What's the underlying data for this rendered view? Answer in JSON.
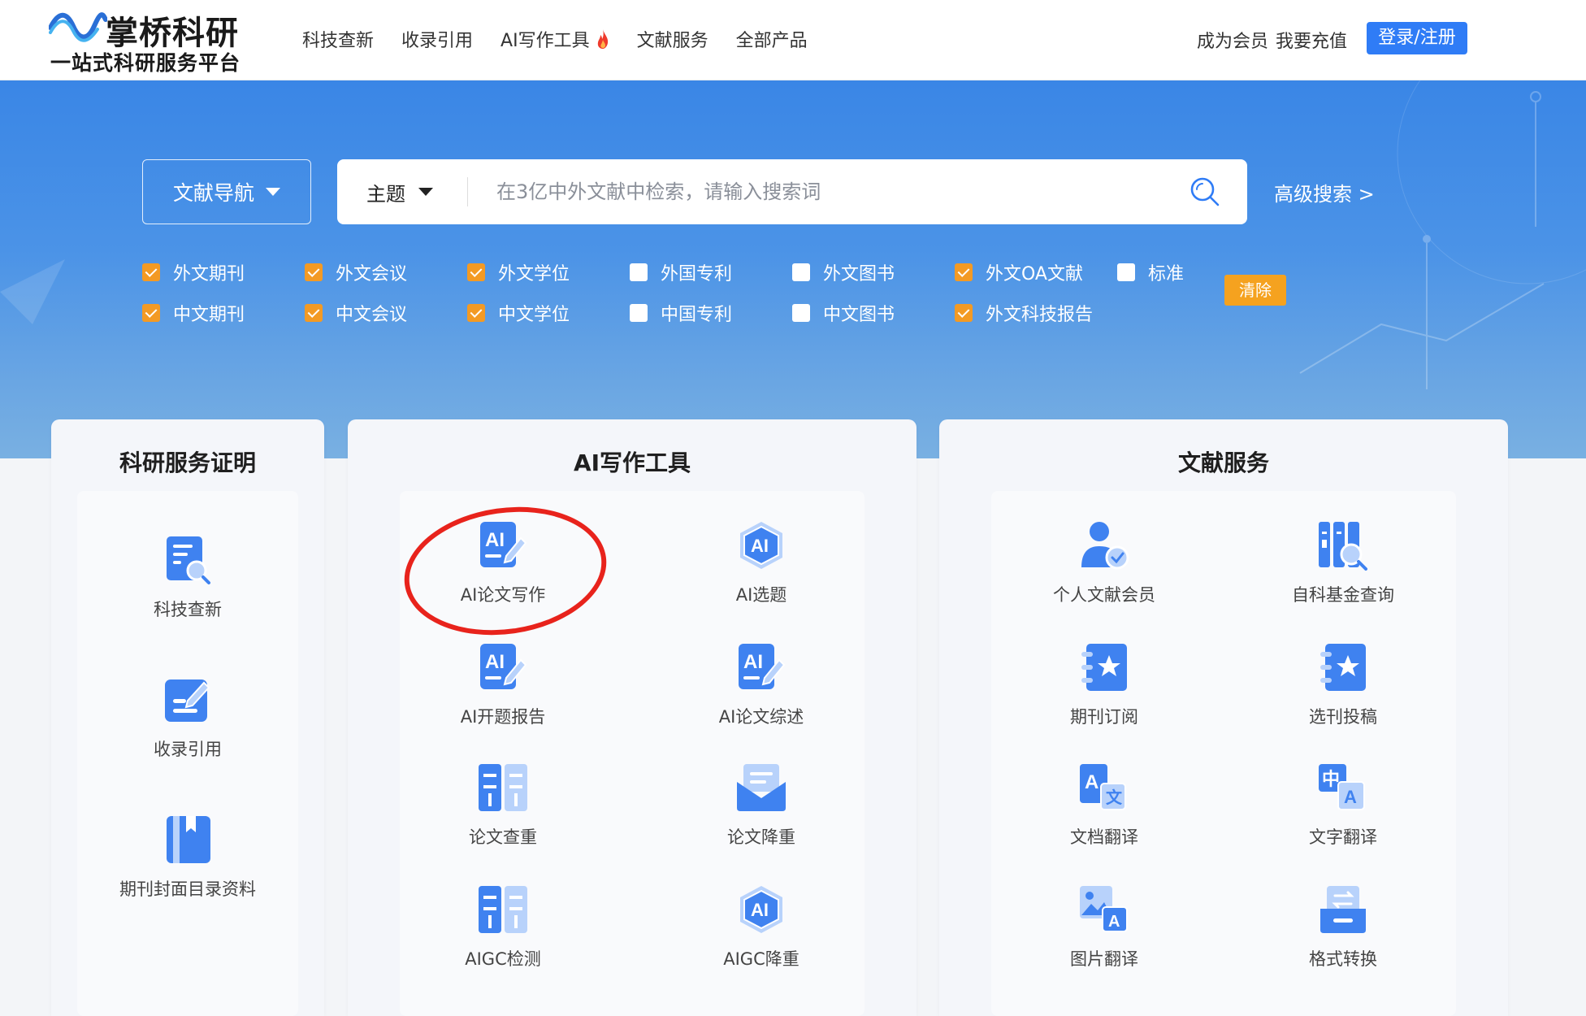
{
  "header": {
    "logo_title": "掌桥科研",
    "logo_subtitle": "一站式科研服务平台",
    "nav": [
      {
        "label": "科技查新"
      },
      {
        "label": "收录引用"
      },
      {
        "label": "AI写作工具",
        "icon": "fire-icon"
      },
      {
        "label": "文献服务"
      },
      {
        "label": "全部产品"
      }
    ],
    "become_member": "成为会员",
    "recharge": "我要充值",
    "login": "登录/注册"
  },
  "search": {
    "nav_dropdown": "文献导航",
    "scope": "主题",
    "placeholder": "在3亿中外文献中检索，请输入搜索词",
    "value": "",
    "advanced": "高级搜索 >"
  },
  "filters": [
    {
      "label": "外文期刊",
      "checked": true
    },
    {
      "label": "外文会议",
      "checked": true
    },
    {
      "label": "外文学位",
      "checked": true
    },
    {
      "label": "外国专利",
      "checked": false
    },
    {
      "label": "外文图书",
      "checked": false
    },
    {
      "label": "外文OA文献",
      "checked": true
    },
    {
      "label": "标准",
      "checked": false
    },
    {
      "label": "中文期刊",
      "checked": true
    },
    {
      "label": "中文会议",
      "checked": true
    },
    {
      "label": "中文学位",
      "checked": true
    },
    {
      "label": "中国专利",
      "checked": false
    },
    {
      "label": "中文图书",
      "checked": false
    },
    {
      "label": "外文科技报告",
      "checked": true
    }
  ],
  "clear_label": "清除",
  "cards": {
    "research": {
      "title": "科研服务证明",
      "items": [
        {
          "label": "科技查新",
          "icon": "doc-search-icon"
        },
        {
          "label": "收录引用",
          "icon": "edit-note-icon"
        },
        {
          "label": "期刊封面目录资料",
          "icon": "book-icon"
        }
      ]
    },
    "ai": {
      "title": "AI写作工具",
      "items": [
        {
          "label": "AI论文写作",
          "icon": "ai-pen-icon"
        },
        {
          "label": "AI选题",
          "icon": "ai-hexagon-icon"
        },
        {
          "label": "AI开题报告",
          "icon": "ai-pen-icon"
        },
        {
          "label": "AI论文综述",
          "icon": "ai-pen-icon"
        },
        {
          "label": "论文查重",
          "icon": "columns-icon"
        },
        {
          "label": "论文降重",
          "icon": "envelope-icon"
        },
        {
          "label": "AIGC检测",
          "icon": "columns-icon"
        },
        {
          "label": "AIGC降重",
          "icon": "ai-hexagon-icon"
        }
      ]
    },
    "literature": {
      "title": "文献服务",
      "items": [
        {
          "label": "个人文献会员",
          "icon": "member-icon"
        },
        {
          "label": "自科基金查询",
          "icon": "fund-search-icon"
        },
        {
          "label": "期刊订阅",
          "icon": "star-book-icon"
        },
        {
          "label": "选刊投稿",
          "icon": "star-book-icon"
        },
        {
          "label": "文档翻译",
          "icon": "doc-translate-icon"
        },
        {
          "label": "文字翻译",
          "icon": "text-translate-icon"
        },
        {
          "label": "图片翻译",
          "icon": "image-translate-icon"
        },
        {
          "label": "格式转换",
          "icon": "format-convert-icon"
        }
      ]
    }
  },
  "colors": {
    "brand_blue": "#2f7cf6",
    "checkbox_orange": "#f39a24",
    "highlight_red": "#e8231c"
  }
}
